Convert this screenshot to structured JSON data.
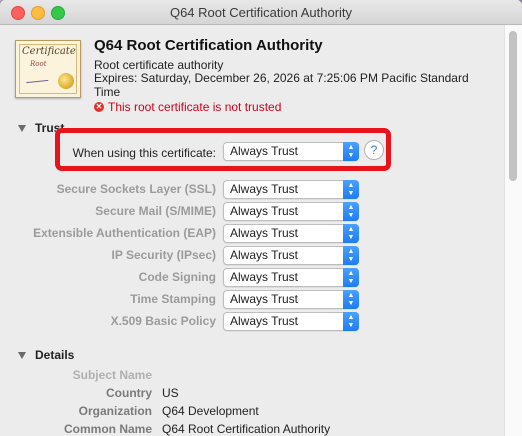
{
  "window": {
    "title": "Q64 Root Certification Authority"
  },
  "certificate": {
    "name": "Q64 Root Certification Authority",
    "kind": "Root certificate authority",
    "expires": "Expires: Saturday, December 26, 2026 at 7:25:06 PM Pacific Standard Time",
    "trust_status": "This root certificate is not trusted",
    "icon_word": "Certificate",
    "icon_subword": "Root"
  },
  "trust": {
    "heading": "Trust",
    "when_using_label": "When using this certificate:",
    "when_using_value": "Always Trust",
    "help_label": "?",
    "rows": [
      {
        "label": "Secure Sockets Layer (SSL)",
        "value": "Always Trust"
      },
      {
        "label": "Secure Mail (S/MIME)",
        "value": "Always Trust"
      },
      {
        "label": "Extensible Authentication (EAP)",
        "value": "Always Trust"
      },
      {
        "label": "IP Security (IPsec)",
        "value": "Always Trust"
      },
      {
        "label": "Code Signing",
        "value": "Always Trust"
      },
      {
        "label": "Time Stamping",
        "value": "Always Trust"
      },
      {
        "label": "X.509 Basic Policy",
        "value": "Always Trust"
      }
    ]
  },
  "details": {
    "heading": "Details",
    "subject_name_label": "Subject Name",
    "fields": [
      {
        "label": "Country",
        "value": "US"
      },
      {
        "label": "Organization",
        "value": "Q64 Development"
      },
      {
        "label": "Common Name",
        "value": "Q64 Root Certification Authority"
      }
    ]
  },
  "colors": {
    "error": "#d0021b",
    "highlight": "#e8141c",
    "accent": "#1f7cf5"
  }
}
